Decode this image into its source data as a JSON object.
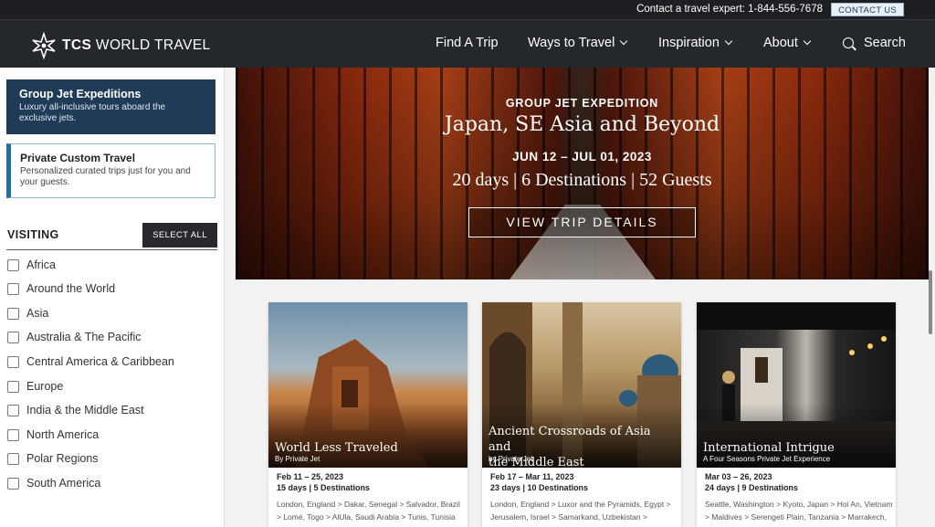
{
  "topbar": {
    "contact_text": "Contact a travel expert: 1-844-556-7678",
    "contact_button": "CONTACT US"
  },
  "nav": {
    "logo_bold": "TCS",
    "logo_rest": " WORLD TRAVEL",
    "items": [
      "Find A Trip",
      "Ways to Travel",
      "Inspiration",
      "About"
    ],
    "search_label": "Search"
  },
  "sidebar": {
    "group_jet": {
      "title": "Group Jet Expeditions",
      "desc": "Luxury all-inclusive tours aboard the exclusive jets."
    },
    "private": {
      "title": "Private Custom Travel",
      "desc": "Personalized curated trips just for you and your guests."
    },
    "visiting_label": "VISITING",
    "select_all": "SELECT ALL",
    "regions": [
      "Africa",
      "Around the World",
      "Asia",
      "Australia & The Pacific",
      "Central America & Caribbean",
      "Europe",
      "India & the Middle East",
      "North America",
      "Polar Regions",
      "South America"
    ]
  },
  "hero": {
    "kicker": "GROUP JET EXPEDITION",
    "title": "Japan, SE Asia and Beyond",
    "dates": "JUN 12 – JUL 01, 2023",
    "stats": "20 days | 6 Destinations | 52 Guests",
    "button": "VIEW TRIP DETAILS"
  },
  "trips": [
    {
      "name": "World Less Traveled",
      "sub": "By Private Jet",
      "dates": "Feb 11 – 25, 2023",
      "count": "15 days | 5 Destinations",
      "line1": "London, England  >  Dakar, Senegal  >  Salvador, Brazil",
      "line2": ">  Lomé, Togo  >  AlUla, Saudi Arabia  >  Tunis, Tunisia"
    },
    {
      "name_line1": "Ancient Crossroads of Asia and",
      "name_line2": "the Middle East",
      "sub": "by Private Jet",
      "dates": "Feb 17 – Mar 11, 2023",
      "count": "23 days | 10 Destinations",
      "line1": "London, England  >  Luxor and the Pyramids, Egypt  >",
      "line2": "Jerusalem, Israel  >  Samarkand, Uzbekistan  >"
    },
    {
      "name": "International Intrigue",
      "sub": "A Four Seasons Private Jet Experience",
      "dates": "Mar 03 – 26, 2023",
      "count": "24 days | 9 Destinations",
      "line1": "Seattle, Washington  >  Kyoto, Japan  >  Hoi An, Vietnam",
      "line2": ">  Maldives  >  Serengeti Plain, Tanzania  >  Marrakech,"
    }
  ]
}
